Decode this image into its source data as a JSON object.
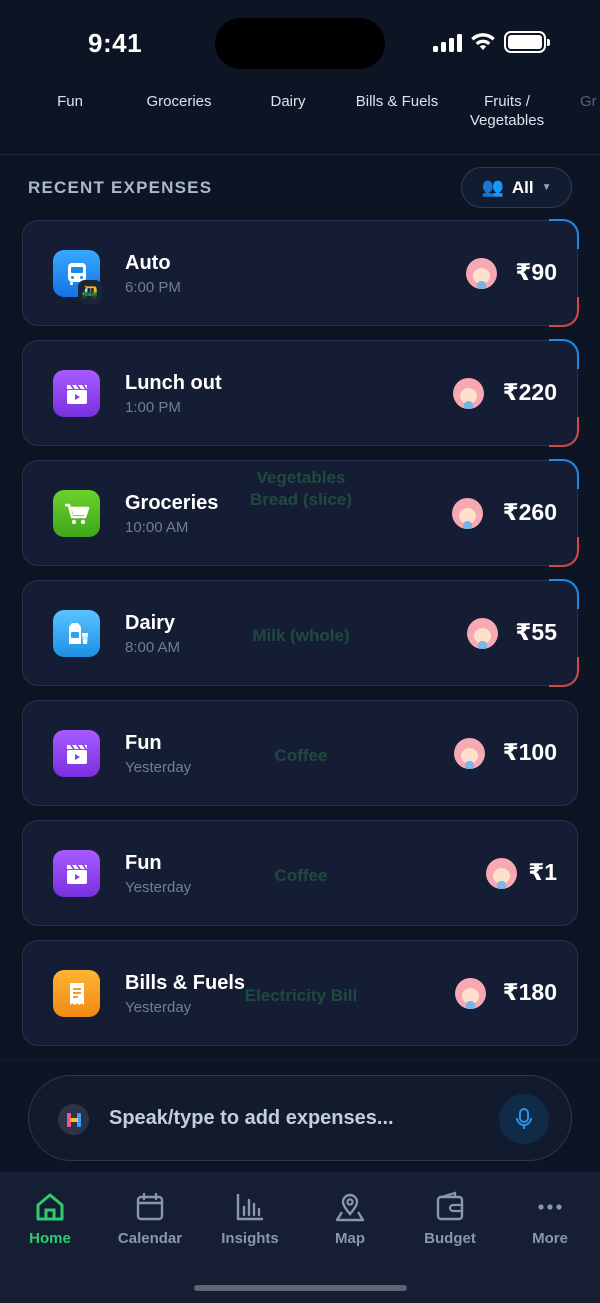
{
  "status_bar": {
    "time": "9:41"
  },
  "categories": [
    "Fun",
    "Groceries",
    "Dairy",
    "Bills & Fuels",
    "Fruits / Vegetables",
    "Gr"
  ],
  "section": {
    "title": "RECENT EXPENSES",
    "filter_label": "All"
  },
  "expenses": [
    {
      "title": "Auto",
      "time": "6:00 PM",
      "note": "",
      "amount": "₹90",
      "icon": "bus-icon",
      "sub_icon": "auto-rickshaw-icon",
      "color": "#1e88e5"
    },
    {
      "title": "Lunch out",
      "time": "1:00 PM",
      "note": "",
      "amount": "₹220",
      "icon": "clapperboard-icon",
      "color": "#8b3ff0"
    },
    {
      "title": "Groceries",
      "time": "10:00 AM",
      "note": "Vegetables\nBread (slice)",
      "amount": "₹260",
      "icon": "cart-icon",
      "color": "#4cbb22"
    },
    {
      "title": "Dairy",
      "time": "8:00 AM",
      "note": "Milk (whole)",
      "amount": "₹55",
      "icon": "milk-icon",
      "color": "#2ba3f0"
    },
    {
      "title": "Fun",
      "time": "Yesterday",
      "note": "Coffee",
      "amount": "₹100",
      "icon": "clapperboard-icon",
      "color": "#8b3ff0"
    },
    {
      "title": "Fun",
      "time": "Yesterday",
      "note": "Coffee",
      "amount": "₹1",
      "icon": "clapperboard-icon",
      "color": "#8b3ff0"
    },
    {
      "title": "Bills & Fuels",
      "time": "Yesterday",
      "note": "Electricity Bill",
      "amount": "₹180",
      "icon": "receipt-icon",
      "color": "#f59b1f"
    }
  ],
  "input": {
    "placeholder": "Speak/type to add expenses..."
  },
  "tabs": [
    {
      "label": "Home",
      "icon": "home-icon",
      "active": true
    },
    {
      "label": "Calendar",
      "icon": "calendar-icon",
      "active": false
    },
    {
      "label": "Insights",
      "icon": "insights-icon",
      "active": false
    },
    {
      "label": "Map",
      "icon": "map-pin-icon",
      "active": false
    },
    {
      "label": "Budget",
      "icon": "wallet-icon",
      "active": false
    },
    {
      "label": "More",
      "icon": "more-icon",
      "active": false
    }
  ],
  "colors": {
    "background": "#0d1424",
    "card": "#141d33",
    "accent_green": "#2ecc71",
    "accent_blue": "#1e88e5",
    "accent_red": "#d64545"
  }
}
